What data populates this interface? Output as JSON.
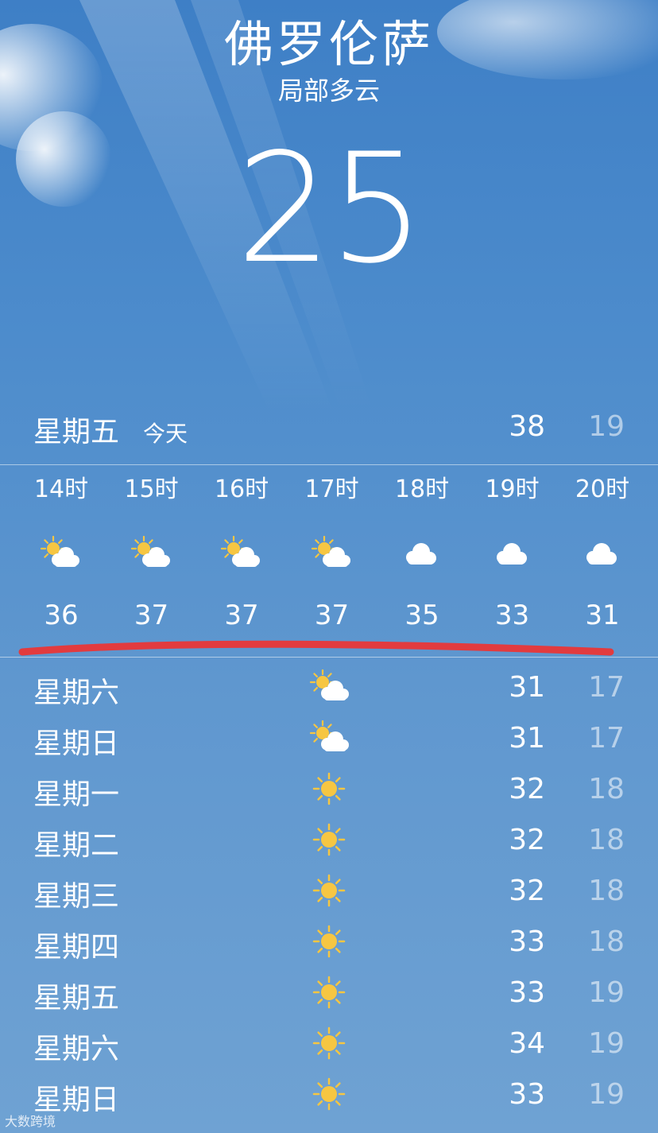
{
  "location": {
    "city": "佛罗伦萨",
    "condition": "局部多云",
    "current_temp": "25"
  },
  "today": {
    "day": "星期五",
    "label": "今天",
    "high": "38",
    "low": "19"
  },
  "hourly": [
    {
      "time": "14时",
      "icon": "partly-sunny-icon",
      "temp": "36"
    },
    {
      "time": "15时",
      "icon": "partly-sunny-icon",
      "temp": "37"
    },
    {
      "time": "16时",
      "icon": "partly-sunny-icon",
      "temp": "37"
    },
    {
      "time": "17时",
      "icon": "partly-sunny-icon",
      "temp": "37"
    },
    {
      "time": "18时",
      "icon": "cloud-icon",
      "temp": "35"
    },
    {
      "time": "19时",
      "icon": "cloud-icon",
      "temp": "33"
    },
    {
      "time": "20时",
      "icon": "cloud-icon",
      "temp": "31"
    }
  ],
  "daily": [
    {
      "day": "星期六",
      "icon": "partly-sunny-icon",
      "high": "31",
      "low": "17"
    },
    {
      "day": "星期日",
      "icon": "partly-sunny-icon",
      "high": "31",
      "low": "17"
    },
    {
      "day": "星期一",
      "icon": "sun-icon",
      "high": "32",
      "low": "18"
    },
    {
      "day": "星期二",
      "icon": "sun-icon",
      "high": "32",
      "low": "18"
    },
    {
      "day": "星期三",
      "icon": "sun-icon",
      "high": "32",
      "low": "18"
    },
    {
      "day": "星期四",
      "icon": "sun-icon",
      "high": "33",
      "low": "18"
    },
    {
      "day": "星期五",
      "icon": "sun-icon",
      "high": "33",
      "low": "19"
    },
    {
      "day": "星期六",
      "icon": "sun-icon",
      "high": "34",
      "low": "19"
    },
    {
      "day": "星期日",
      "icon": "sun-icon",
      "high": "33",
      "low": "19"
    }
  ],
  "annotation": {
    "color": "#e23b3f"
  },
  "colors": {
    "sun": "#f6c642",
    "cloud": "#ffffff"
  },
  "watermark": "大数跨境"
}
